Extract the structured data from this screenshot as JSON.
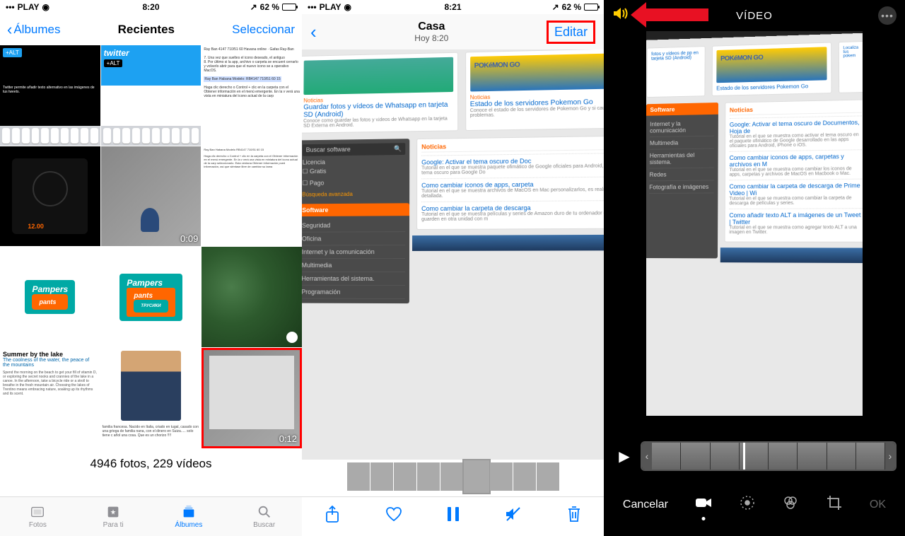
{
  "panel1": {
    "status": {
      "carrier": "PLAY",
      "time": "8:20",
      "battery": "62 %"
    },
    "nav": {
      "back": "Álbumes",
      "title": "Recientes",
      "select": "Seleccionar"
    },
    "thumbs": {
      "twitter_alt": "+ALT",
      "twitter_caption": "Twitter permite añadir texto alternativo en las imágenes de tus tweets.",
      "vid1_duration": "0:09",
      "pampers": "Pampers pants",
      "article_title": "Summer by the lake",
      "article_sub": "The coolness of the water, the peace of the mountains",
      "article_body": "Spend the morning on the beach to get your fill of vitamin D, or exploring the secret nooks and crannies of the lake in a canoe. In the afternoon, take a bicycle ride or a stroll to breathe in the fresh mountain air. Choosing the lakes of Trentino means embracing nature, soaking up its rhythms and its scent.",
      "person_caption": "familia francesa. Nacido en Italia, criado en tugal, casado con una griega de familia nana, con el dinero en Suiza..... solo tiene c añol una cosa. Que es un chorizo !!!!",
      "vid2_duration": "0:12",
      "induction_price": "12.00"
    },
    "footer_counts": "4946 fotos, 229 vídeos",
    "tabs": {
      "fotos": "Fotos",
      "parati": "Para ti",
      "albumes": "Álbumes",
      "buscar": "Buscar"
    }
  },
  "panel2": {
    "status": {
      "carrier": "PLAY",
      "time": "8:21",
      "battery": "62 %"
    },
    "nav": {
      "title": "Casa",
      "subtitle": "Hoy  8:20",
      "edit": "Editar"
    },
    "mock": {
      "noticias": "Noticias",
      "whatsapp_title": "Guardar fotos y vídeos de Whatsapp en tarjeta SD (Android)",
      "whatsapp_desc": "Conoce como guardar las fotos y videos de Whatsapp en la tarjeta SD Externa en Android.",
      "pokemon_title": "Estado de los servidores Pokemon Go",
      "pokemon_desc": "Conoce el estado de los servidores de Pokemon Go y si causan tus problemas.",
      "buscar": "Buscar software",
      "licencia": "Licencia",
      "gratis": "Gratis",
      "pago": "Pago",
      "adv": "Búsqueda avanzada",
      "software": "Software",
      "sw_items": [
        "Seguridad",
        "Oficina",
        "Internet y la comunicación",
        "Multimedia",
        "Herramientas del sistema.",
        "Programación"
      ],
      "news_items": [
        {
          "t": "Google: Activar el tema oscuro de Doc",
          "d": "Tutorial en el que se muestra paquete ofimático de Google oficiales para Android, iPhone tema oscuro para Google Do"
        },
        {
          "t": "Como cambiar iconos de apps, carpeta",
          "d": "Tutorial en el que se muestra archivos de MacOS en Mac personalizarlos, es realmente detallada."
        },
        {
          "t": "Como cambiar la carpeta de descarga",
          "d": "Tutorial en el que se muestra películas y series de Amazon duro de tu ordenador con Win guarden en otra unidad con m"
        }
      ]
    }
  },
  "panel3": {
    "title": "VÍDEO",
    "cancel": "Cancelar",
    "ok": "OK",
    "mock": {
      "pokemon_title": "Estado de los servidores Pokemon Go",
      "whatsapp_sub": "fotos y vídeos de pp en tarjeta SD (Android)",
      "loc": "Localiza tus pokem",
      "news_items": [
        {
          "t": "Google: Activar el tema oscuro de Documentos, Hoja de",
          "d": "Tutorial en el que se muestra como activar el tema oscuro en el paquete ofimático de Google desarrollado en las apps oficiales para Android, iPhone o iOS."
        },
        {
          "t": "Como cambiar iconos de apps, carpetas y archivos en M",
          "d": "Tutorial en el que se muestra como cambiar los iconos de apps, carpetas y archivos de MacOS en Macbook o Mac."
        },
        {
          "t": "Como cambiar la carpeta de descarga de Prime Video | Wi",
          "d": "Tutorial en el que se muestra como cambiar la carpeta de descarga de películas y series."
        },
        {
          "t": "Como añadir texto ALT a imágenes de un Tweet | Twitter",
          "d": "Tutorial en el que se muestra como agregar texto ALT a una imagen en Twitter."
        }
      ]
    }
  },
  "annotations": {
    "red_arrow": "points to speaker/mute icon",
    "red_box_editar": true,
    "red_box_video_thumb": true
  },
  "colors": {
    "ios_blue": "#007aff",
    "red": "#f00",
    "orange": "#f60",
    "yellow": "#ffcc00"
  }
}
